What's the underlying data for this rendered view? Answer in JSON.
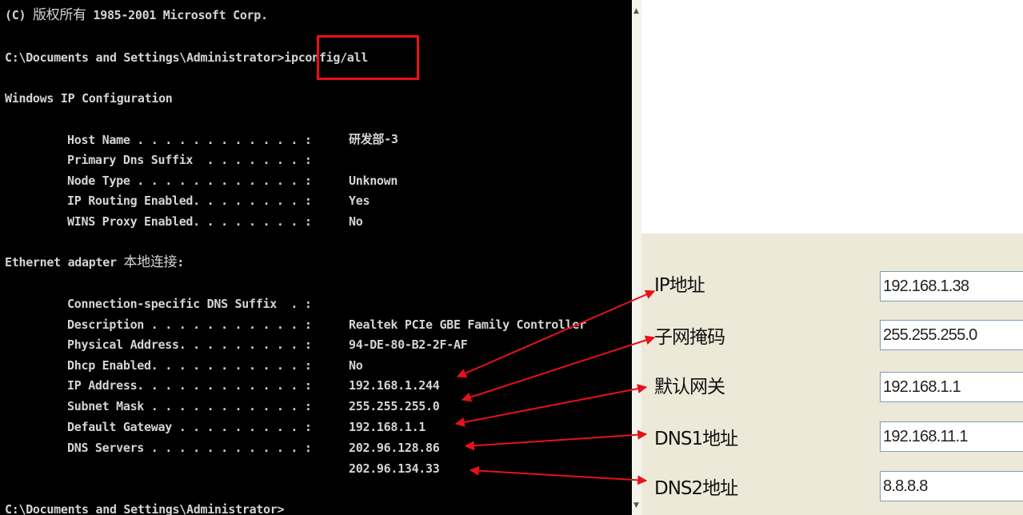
{
  "console": {
    "copyright_prefix": "(C) ",
    "copyright_cjk": "版权所有",
    "copyright_suffix": " 1985-2001 Microsoft Corp.",
    "prompt_path": "C:\\Documents and Settings\\Administrator>",
    "command": "ipconfig/all",
    "header": "Windows IP Configuration",
    "ip_config": [
      {
        "label": "Host Name . . . . . . . . . . . . :",
        "value": "研发部-3"
      },
      {
        "label": "Primary Dns Suffix  . . . . . . . :",
        "value": ""
      },
      {
        "label": "Node Type . . . . . . . . . . . . :",
        "value": "Unknown"
      },
      {
        "label": "IP Routing Enabled. . . . . . . . :",
        "value": "Yes"
      },
      {
        "label": "WINS Proxy Enabled. . . . . . . . :",
        "value": "No"
      }
    ],
    "adapter_prefix": "Ethernet adapter ",
    "adapter_name": "本地连接",
    "adapter_suffix": ":",
    "adapter": [
      {
        "label": "Connection-specific DNS Suffix  . :",
        "value": ""
      },
      {
        "label": "Description . . . . . . . . . . . :",
        "value": "Realtek PCIe GBE Family Controller"
      },
      {
        "label": "Physical Address. . . . . . . . . :",
        "value": "94-DE-80-B2-2F-AF"
      },
      {
        "label": "Dhcp Enabled. . . . . . . . . . . :",
        "value": "No"
      },
      {
        "label": "IP Address. . . . . . . . . . . . :",
        "value": "192.168.1.244"
      },
      {
        "label": "Subnet Mask . . . . . . . . . . . :",
        "value": "255.255.255.0"
      },
      {
        "label": "Default Gateway . . . . . . . . . :",
        "value": "192.168.1.1"
      },
      {
        "label": "DNS Servers . . . . . . . . . . . :",
        "value": "202.96.128.86"
      },
      {
        "label": "",
        "value": "202.96.134.33"
      }
    ],
    "final_prompt": "C:\\Documents and Settings\\Administrator>"
  },
  "settings": {
    "fields": [
      {
        "label": "IP地址",
        "value": "192.168.1.38"
      },
      {
        "label": "子网掩码",
        "value": "255.255.255.0"
      },
      {
        "label": "默认网关",
        "value": "192.168.1.1"
      },
      {
        "label": "DNS1地址",
        "value": "192.168.11.1"
      },
      {
        "label": "DNS2地址",
        "value": "8.8.8.8"
      }
    ]
  },
  "colors": {
    "console_bg": "#000000",
    "console_text": "#d4d4d4",
    "annotation_red": "#e8101a",
    "panel_bg": "#ece9d8"
  }
}
